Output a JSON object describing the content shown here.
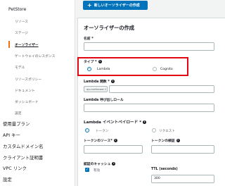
{
  "sidebar": {
    "api_name": "PetStore",
    "sub_items": [
      {
        "label": "リソース"
      },
      {
        "label": "ステージ"
      },
      {
        "label": "オーソライザー"
      },
      {
        "label": "ゲートウェイのレスポンス"
      },
      {
        "label": "モデル"
      },
      {
        "label": "リソースポリシー"
      },
      {
        "label": "ドキュメント"
      },
      {
        "label": "ダッシュボード"
      },
      {
        "label": "設定"
      }
    ],
    "top_items": [
      {
        "label": "使用量プラン"
      },
      {
        "label": "API キー"
      },
      {
        "label": "カスタムドメイン名"
      },
      {
        "label": "クライアント証明書"
      },
      {
        "label": "VPC リンク"
      },
      {
        "label": "設定"
      }
    ],
    "accent_color": "#ec7211"
  },
  "toolbar": {
    "create_button_label": "新しいオーソライザーの作成"
  },
  "form": {
    "title": "オーソライザーの作成",
    "name_label": "名前 *",
    "type_label": "タイプ *",
    "type_options": {
      "lambda": "Lambda",
      "cognito": "Cognito"
    },
    "lambda_function_label": "Lambda 関数 *",
    "region_value": "ap-northeast-1",
    "lambda_invoke_role_label": "Lambda 呼び出しロール",
    "event_payload_label": "Lambda イベントペイロード *",
    "payload_options": {
      "token": "トークン",
      "request": "リクエスト"
    },
    "token_source_label": "トークンのソース*",
    "token_validation_label": "トークンの検証",
    "cache_label": "認証のキャッシュ",
    "cache_enabled_label": "有効",
    "ttl_label": "TTL (seconds)",
    "ttl_value": "300"
  },
  "colors": {
    "primary": "#0073bb",
    "highlight": "#e30613"
  }
}
